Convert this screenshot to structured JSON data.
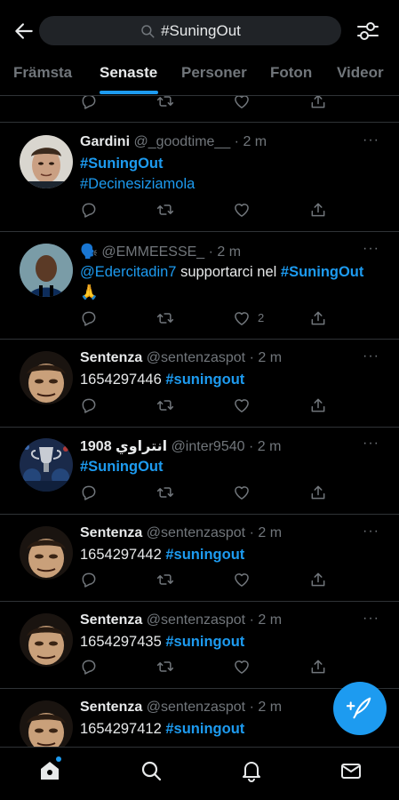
{
  "search": {
    "query": "#SuningOut"
  },
  "tabs": [
    {
      "label": "Främsta"
    },
    {
      "label": "Senaste"
    },
    {
      "label": "Personer"
    },
    {
      "label": "Foton"
    },
    {
      "label": "Videor"
    }
  ],
  "active_tab": "Senaste",
  "tweets": [
    {
      "name": "Gardini",
      "meta": "@_goodtime__ · 2 m",
      "line1_tag": "#SuningOut",
      "line2_tag": "#Decinesiziamola"
    },
    {
      "name": "🗣️",
      "meta": "@EMMEESSE_ · 2 m",
      "mention": "@Edercitadin7",
      "text": " supportarci nel ",
      "tag": "#SuningOut",
      "emoji": "🙏",
      "like_count": "2"
    },
    {
      "name": "Sentenza",
      "meta": "@sentenzaspot · 2 m",
      "number": "1654297446",
      "tag": "#suningout"
    },
    {
      "name": "انتراوي 1908",
      "meta": "@inter9540 · 2 m",
      "tag": "#SuningOut"
    },
    {
      "name": "Sentenza",
      "meta": "@sentenzaspot · 2 m",
      "number": "1654297442",
      "tag": "#suningout"
    },
    {
      "name": "Sentenza",
      "meta": "@sentenzaspot · 2 m",
      "number": "1654297435",
      "tag": "#suningout"
    },
    {
      "name": "Sentenza",
      "meta": "@sentenzaspot · 2 m",
      "number": "1654297412",
      "tag": "#suningout"
    }
  ],
  "more_label": "···",
  "colors": {
    "accent": "#1d9bf0",
    "muted": "#71767b",
    "text": "#e7e9ea",
    "bg": "#000000"
  }
}
